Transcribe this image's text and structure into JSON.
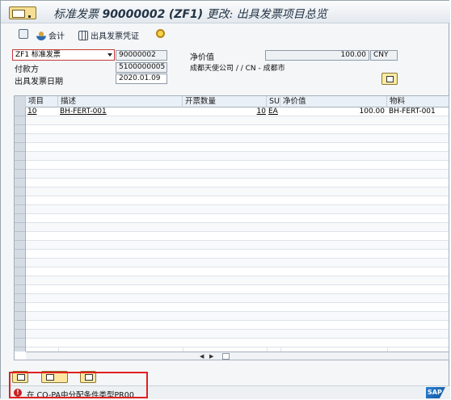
{
  "window": {
    "title_prefix": "标准发票",
    "title_number": "90000002",
    "title_type": "(ZF1)",
    "title_suffix": "更改: 出具发票项目总览"
  },
  "toolbar": {
    "accounting_label": "会计",
    "billing_doc_label": "出具发票凭证"
  },
  "header": {
    "billing_type_value": "ZF1 标准发票",
    "billing_number_value": "90000002",
    "net_value_label": "净价值",
    "net_value_amount": "100.00",
    "currency": "CNY",
    "payer_label": "付款方",
    "payer_value": "5100000005",
    "payer_address": "成都天使公司 / / CN - 成都市",
    "billing_date_label": "出具发票日期",
    "billing_date_value": "2020.01.09"
  },
  "table": {
    "columns": [
      "项目",
      "描述",
      "开票数量",
      "SU",
      "净价值",
      "物料"
    ],
    "rows": [
      {
        "item": "10",
        "description": "BH-FERT-001",
        "quantity": "10",
        "su": "EA",
        "net_value": "100.00",
        "material": "BH-FERT-001"
      }
    ]
  },
  "status": {
    "type": "error",
    "message": "在 CO-PA中分配条件类型PR00",
    "logo_text": "SAP"
  }
}
